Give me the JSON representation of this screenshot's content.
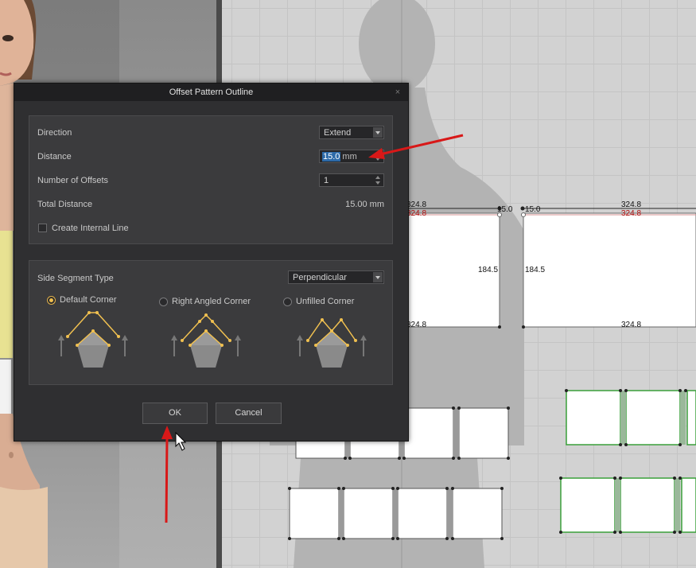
{
  "dialog": {
    "title": "Offset Pattern Outline",
    "close_glyph": "×",
    "offset_group": {
      "direction_label": "Direction",
      "direction_value": "Extend",
      "distance_label": "Distance",
      "distance_value": "15.0",
      "distance_unit": "mm",
      "num_offsets_label": "Number of Offsets",
      "num_offsets_value": "1",
      "total_distance_label": "Total Distance",
      "total_distance_value": "15.00 mm",
      "create_internal_line_label": "Create Internal Line"
    },
    "side_group": {
      "side_segment_type_label": "Side Segment Type",
      "side_segment_type_value": "Perpendicular",
      "options": [
        {
          "label": "Default Corner",
          "selected": true
        },
        {
          "label": "Right Angled Corner",
          "selected": false
        },
        {
          "label": "Unfilled Corner",
          "selected": false
        }
      ]
    },
    "ok_label": "OK",
    "cancel_label": "Cancel"
  },
  "pattern_dims": {
    "left_top_black": "324.8",
    "left_top_red": "324.8",
    "left_offset": "15.0",
    "left_side": "184.5",
    "left_bottom": "324.8",
    "right_offset": "15.0",
    "right_top_black": "324.8",
    "right_top_red": "324.8",
    "right_side": "184.5",
    "right_bottom": "324.8"
  },
  "colors": {
    "accent": "#f0c050",
    "annotation_arrow": "#d81818",
    "selected_piece": "#3aa03a"
  }
}
